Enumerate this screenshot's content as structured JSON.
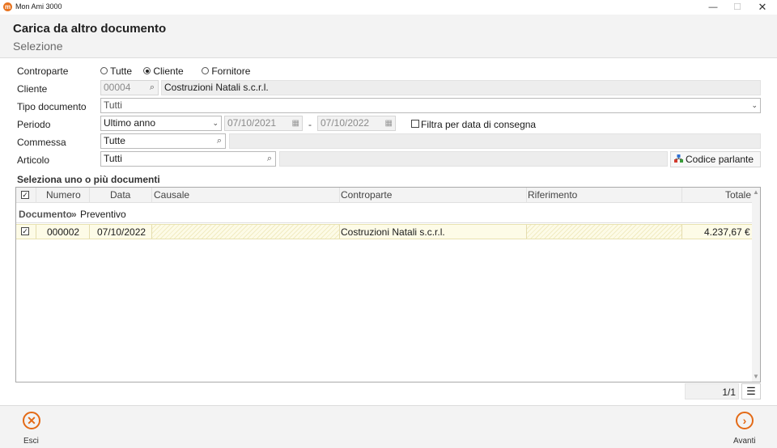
{
  "window": {
    "app_title": "Mon Ami 3000",
    "min": "—",
    "max": "☐",
    "close": "✕"
  },
  "header": {
    "title": "Carica da altro documento",
    "subtitle": "Selezione"
  },
  "form": {
    "controparte": {
      "label": "Controparte",
      "options": [
        "Tutte",
        "Cliente",
        "Fornitore"
      ],
      "selected": "Cliente"
    },
    "cliente": {
      "label": "Cliente",
      "code": "00004",
      "name": "Costruzioni Natali s.c.r.l."
    },
    "tipo_documento": {
      "label": "Tipo documento",
      "value": "Tutti"
    },
    "periodo": {
      "label": "Periodo",
      "value": "Ultimo anno",
      "from": "07/10/2021",
      "separator": "-",
      "to": "07/10/2022",
      "filter_label": "Filtra per data di consegna",
      "filter_checked": false
    },
    "commessa": {
      "label": "Commessa",
      "value": "Tutte"
    },
    "articolo": {
      "label": "Articolo",
      "value": "Tutti",
      "button": "Codice parlante"
    }
  },
  "grid": {
    "section_title": "Seleziona uno o più documenti",
    "columns": [
      "Numero",
      "Data",
      "Causale",
      "Controparte",
      "Riferimento",
      "Totale"
    ],
    "group": {
      "field": "Documento",
      "separator": "»",
      "value": "Preventivo"
    },
    "rows": [
      {
        "checked": true,
        "numero": "000002",
        "data": "07/10/2022",
        "causale": "",
        "controparte": "Costruzioni Natali s.c.r.l.",
        "riferimento": "",
        "totale": "4.237,67 €"
      }
    ],
    "pager": "1/1"
  },
  "footer": {
    "esci": "Esci",
    "avanti": "Avanti"
  },
  "colors": {
    "accent": "#e36a16",
    "row_highlight": "#fdfbe7"
  },
  "icons": [
    "app-logo-icon",
    "search-icon",
    "calendar-icon",
    "chevron-down-icon",
    "codice-parlante-icon",
    "menu-icon",
    "close-circle-icon",
    "arrow-right-circle-icon"
  ]
}
